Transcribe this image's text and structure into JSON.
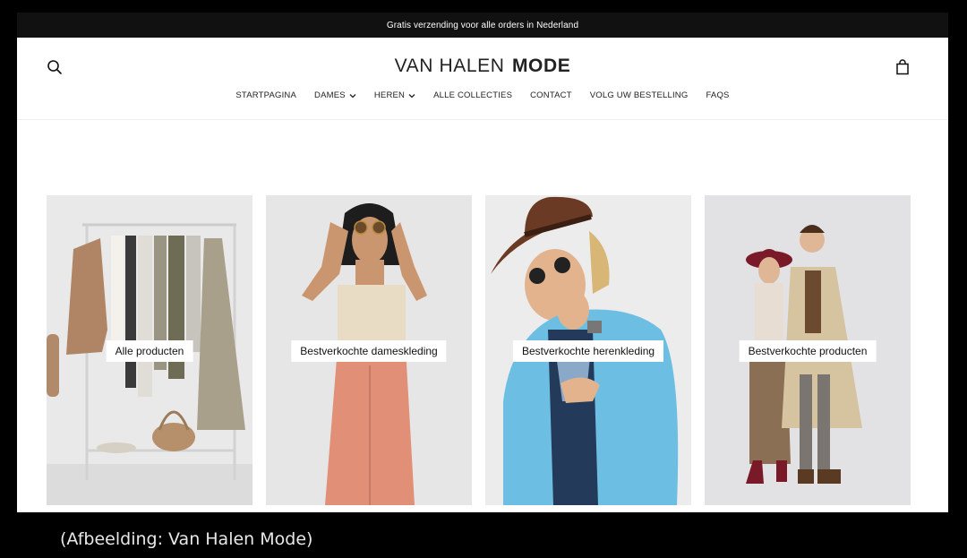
{
  "announcement": {
    "text": "Gratis verzending voor alle orders in Nederland"
  },
  "header": {
    "logo_light": "VAN HALEN",
    "logo_bold": "MODE",
    "search_icon": "search-icon",
    "cart_icon": "shopping-bag-icon"
  },
  "nav": {
    "items": [
      {
        "label": "STARTPAGINA",
        "dropdown": false
      },
      {
        "label": "DAMES",
        "dropdown": true
      },
      {
        "label": "HEREN",
        "dropdown": true
      },
      {
        "label": "ALLE COLLECTIES",
        "dropdown": false
      },
      {
        "label": "CONTACT",
        "dropdown": false
      },
      {
        "label": "VOLG UW BESTELLING",
        "dropdown": false
      },
      {
        "label": "FAQS",
        "dropdown": false
      }
    ]
  },
  "collections": [
    {
      "label": "Alle producten"
    },
    {
      "label": "Bestverkochte dameskleding"
    },
    {
      "label": "Bestverkochte herenkleding"
    },
    {
      "label": "Bestverkochte producten"
    }
  ],
  "caption": "(Afbeelding: Van Halen Mode)",
  "colors": {
    "announce_bg": "#111111",
    "page_bg": "#000000",
    "card_label_bg": "#ffffff"
  }
}
